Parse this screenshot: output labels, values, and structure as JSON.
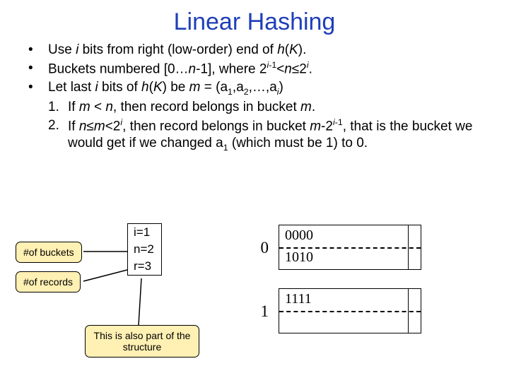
{
  "title": "Linear Hashing",
  "bullets": {
    "b1": "Use <span class='i'>i</span> bits from right (low-order) end of <span class='i'>h</span>(<span class='i'>K</span>).",
    "b2": "Buckets numbered [0…<span class='i'>n</span>-1], where 2<sup><span class='i'>i</span>-1</sup>&lt;<span class='i'>n</span>≤2<sup><span class='i'>i</span></sup>.",
    "b3": "Let last <span class='i'>i</span> bits of <span class='i'>h</span>(<span class='i'>K</span>) be <span class='i'>m</span> = (a<sub>1</sub>,a<sub>2</sub>,…,a<sub><span class='i'>i</span></sub>)",
    "n1": "If <span class='i'>m</span> &lt; <span class='i'>n</span>, then record belongs in bucket <span class='i'>m</span>.",
    "n2": "If <span class='i'>n</span>≤<span class='i'>m</span>&lt;2<sup><span class='i'>i</span></sup>, then record belongs in bucket <span class='i'>m</span>-2<sup><span class='i'>i</span>-1</sup>, that is the bucket we would get if we changed a<sub>1</sub> (which must be 1) to 0."
  },
  "params": {
    "p1": "i=1",
    "p2": "n=2",
    "p3": "r=3"
  },
  "callouts": {
    "c1": "#of buckets",
    "c2": "#of records",
    "c3": "This is also part of the structure"
  },
  "buckets": {
    "idx0": "0",
    "idx1": "1",
    "r0a": "0000",
    "r0b": "1010",
    "r1a": "1111"
  }
}
